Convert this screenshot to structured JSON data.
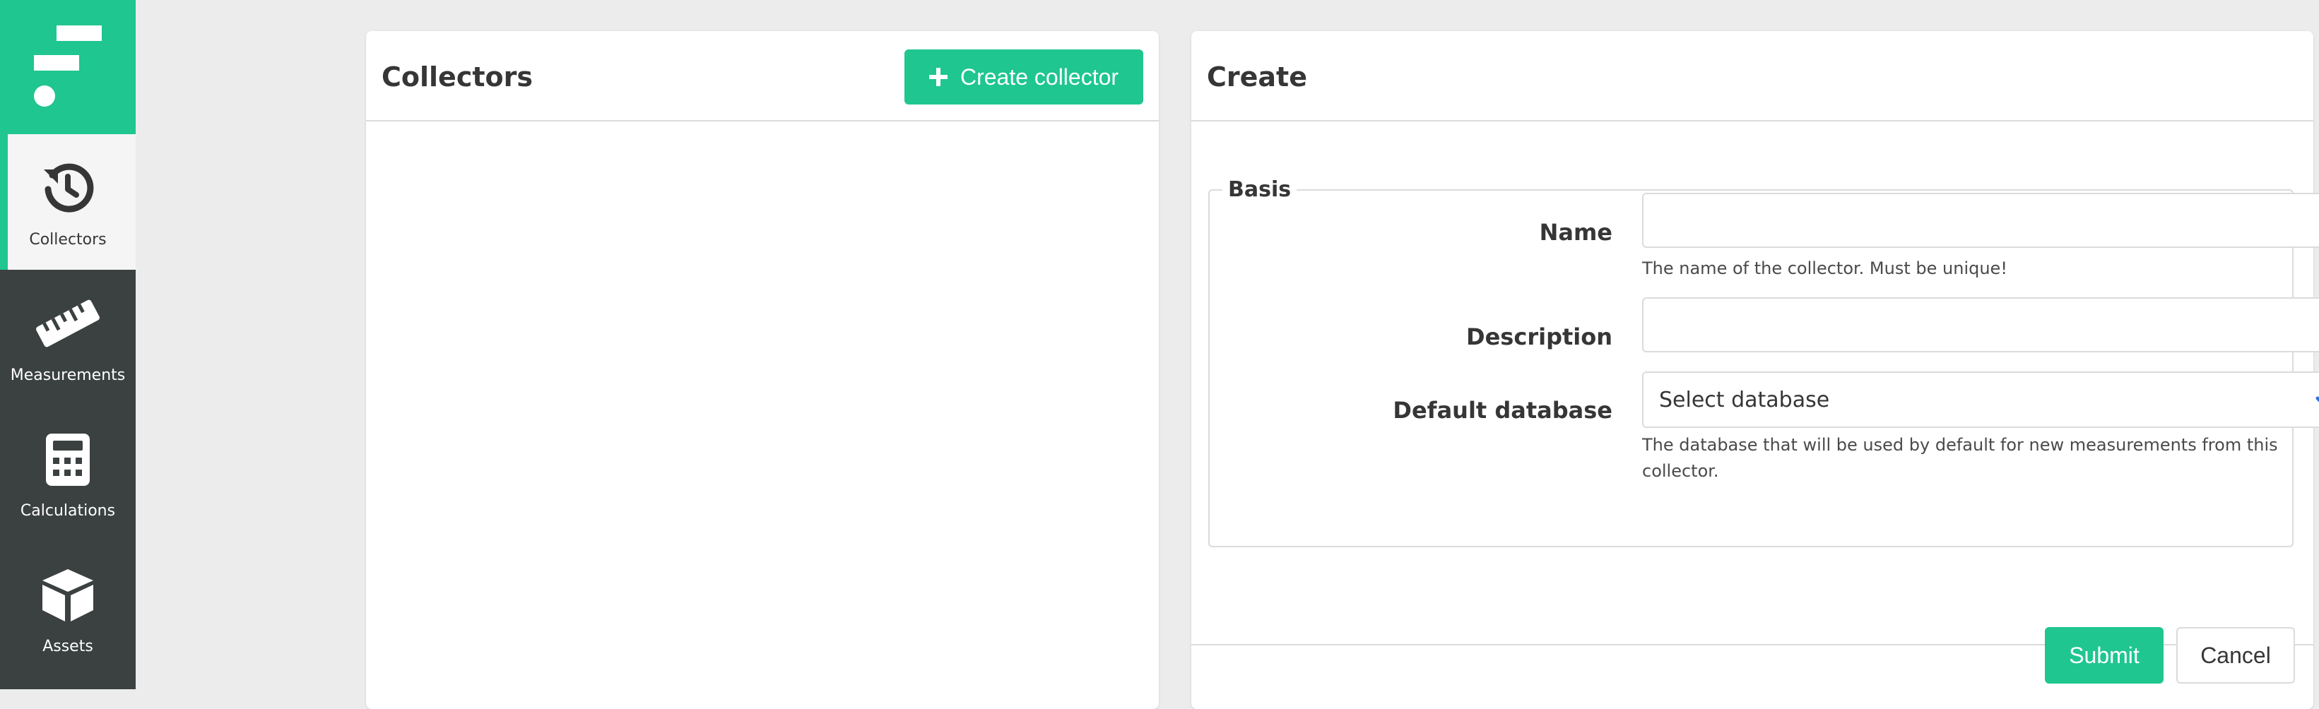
{
  "sidebar": {
    "items": [
      {
        "label": "Collectors",
        "icon": "history-icon",
        "active": true
      },
      {
        "label": "Measurements",
        "icon": "ruler-icon",
        "active": false
      },
      {
        "label": "Calculations",
        "icon": "calculator-icon",
        "active": false
      },
      {
        "label": "Assets",
        "icon": "cube-icon",
        "active": false
      }
    ]
  },
  "collectors_panel": {
    "title": "Collectors",
    "create_button_label": "Create collector"
  },
  "create_panel": {
    "title": "Create",
    "fieldset_legend": "Basis",
    "fields": {
      "name": {
        "label": "Name",
        "value": "",
        "placeholder": "",
        "help": "The name of the collector. Must be unique!"
      },
      "description": {
        "label": "Description",
        "value": "",
        "placeholder": ""
      },
      "default_database": {
        "label": "Default database",
        "selected": "Select database",
        "help": "The database that will be used by default for new measurements from this collector."
      }
    },
    "submit_label": "Submit",
    "cancel_label": "Cancel"
  },
  "colors": {
    "accent": "#1fc68f",
    "sidebar": "#3b4040",
    "chevron": "#3273dc"
  }
}
